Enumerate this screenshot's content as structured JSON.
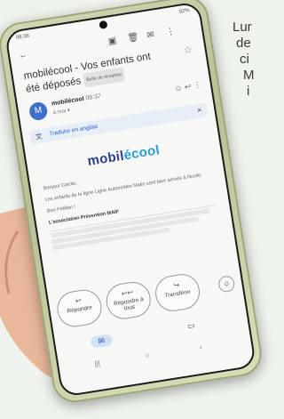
{
  "article": {
    "lines": [
      "Lur",
      "de",
      "ci",
      "M",
      "i"
    ]
  },
  "status": {
    "time": "08:36",
    "battery": "92%"
  },
  "email": {
    "subject": "mobilécool - Vos enfants ont été déposés",
    "label": "Boîte de réception",
    "sender_name": "mobilécool",
    "sender_time": "08:37",
    "recipient": "à moi",
    "avatar_letter": "M",
    "translate_text": "Traduire en anglais",
    "logo_main": "mobil",
    "logo_accent": "écool",
    "greeting": "Bonjour Carole,",
    "message": "Les enfants de la ligne Ligne Autonoïdes Matin sont bien arrivés à l'école.",
    "signoff": "Bon Pétillon !",
    "signature": "L'association Prévention MAIF"
  },
  "actions": {
    "reply": "Répondre",
    "reply_all": "Répondre à tous",
    "forward": "Transférer"
  }
}
